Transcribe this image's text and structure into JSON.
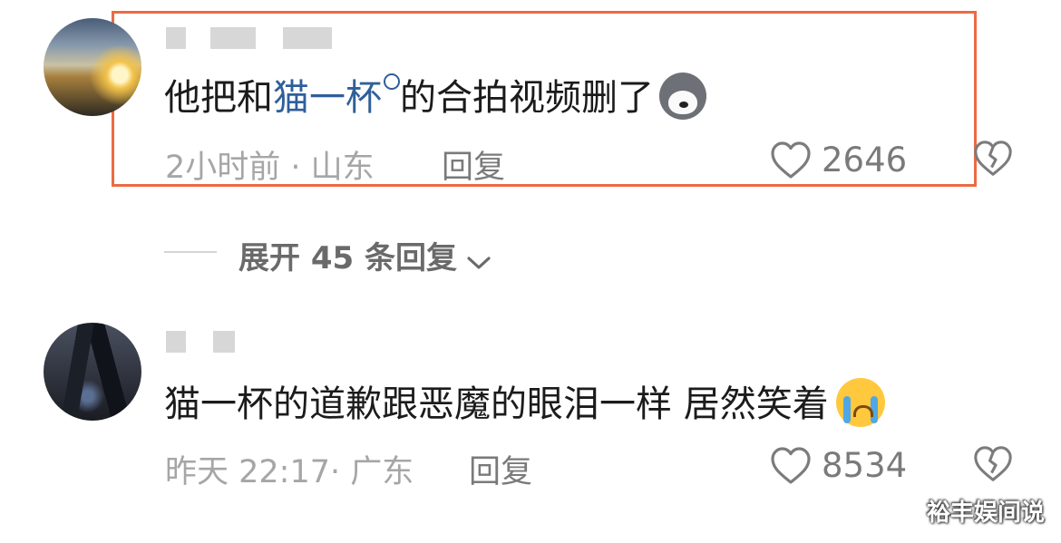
{
  "comments": [
    {
      "text_before": "他把和",
      "link_text": "猫一杯",
      "text_after": "的合拍视频删了",
      "emoji_icon": "husky-dog-emoji",
      "meta": "2小时前 · 山东",
      "reply_label": "回复",
      "likes": "2646",
      "highlighted": true
    },
    {
      "text": "猫一杯的道歉跟恶魔的眼泪一样 居然笑着",
      "emoji_icon": "crying-face-emoji",
      "meta": "昨天 22:17· 广东",
      "reply_label": "回复",
      "likes": "8534"
    }
  ],
  "expand_replies": {
    "label": "展开 45 条回复"
  },
  "watermark": "裕丰娱间说",
  "colors": {
    "highlight_border": "#ea6b43",
    "link": "#2f5f9a"
  }
}
